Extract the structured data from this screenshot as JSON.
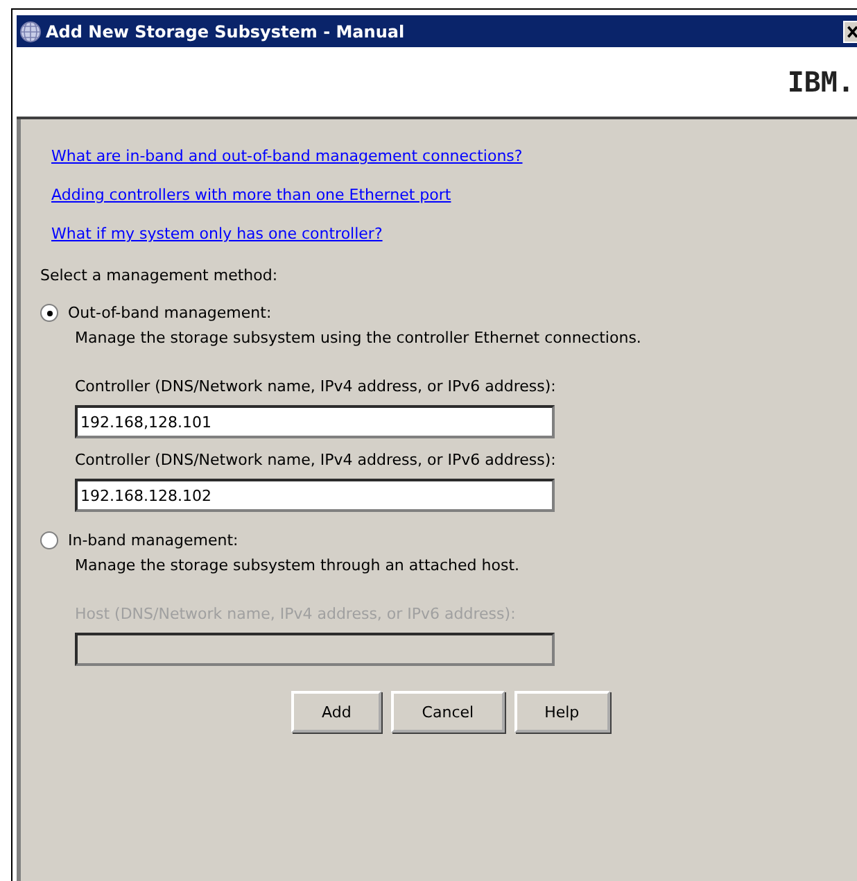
{
  "window": {
    "title": "Add New Storage Subsystem - Manual"
  },
  "header": {
    "logo": "IBM."
  },
  "links": [
    "What are in-band and out-of-band management connections?",
    "Adding controllers with more than one Ethernet port",
    "What if my system only has one controller?"
  ],
  "prompt": "Select a management method:",
  "options": [
    {
      "label": "Out-of-band management:",
      "description": "Manage the storage subsystem using the controller Ethernet connections.",
      "selected": true,
      "fields": [
        {
          "label": "Controller (DNS/Network name, IPv4 address, or IPv6 address):",
          "value": "192.168,128.101",
          "disabled": false
        },
        {
          "label": "Controller (DNS/Network name, IPv4 address, or IPv6 address):",
          "value": "192.168.128.102",
          "disabled": false
        }
      ]
    },
    {
      "label": "In-band management:",
      "description": "Manage the storage subsystem through an attached host.",
      "selected": false,
      "fields": [
        {
          "label": "Host (DNS/Network name, IPv4 address, or IPv6 address):",
          "disabled": true
        }
      ]
    }
  ],
  "buttons": [
    "Add",
    "Cancel",
    "Help"
  ]
}
